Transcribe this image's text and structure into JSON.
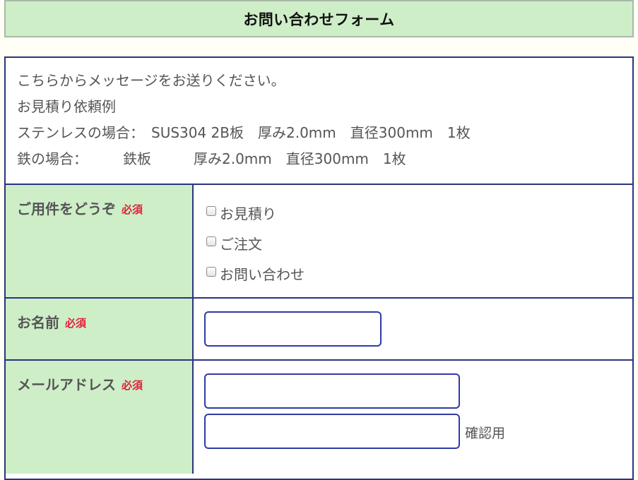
{
  "header": {
    "title": "お問い合わせフォーム"
  },
  "intro": {
    "line1": "こちらからメッセージをお送りください。",
    "line2": "お見積り依頼例",
    "line3": "ステンレスの場合：　SUS304 2B板　厚み2.0mm　直径300mm　1枚",
    "line4": "鉄の場合：　　　鉄板　　　厚み2.0mm　直径300mm　1枚"
  },
  "subject": {
    "label": "ご用件をどうぞ",
    "required": "必須",
    "options": [
      "お見積り",
      "ご注文",
      "お問い合わせ"
    ]
  },
  "name": {
    "label": "お名前",
    "required": "必須",
    "value": ""
  },
  "email": {
    "label": "メールアドレス",
    "required": "必須",
    "value": "",
    "confirm_value": "",
    "confirm_label": "確認用"
  }
}
